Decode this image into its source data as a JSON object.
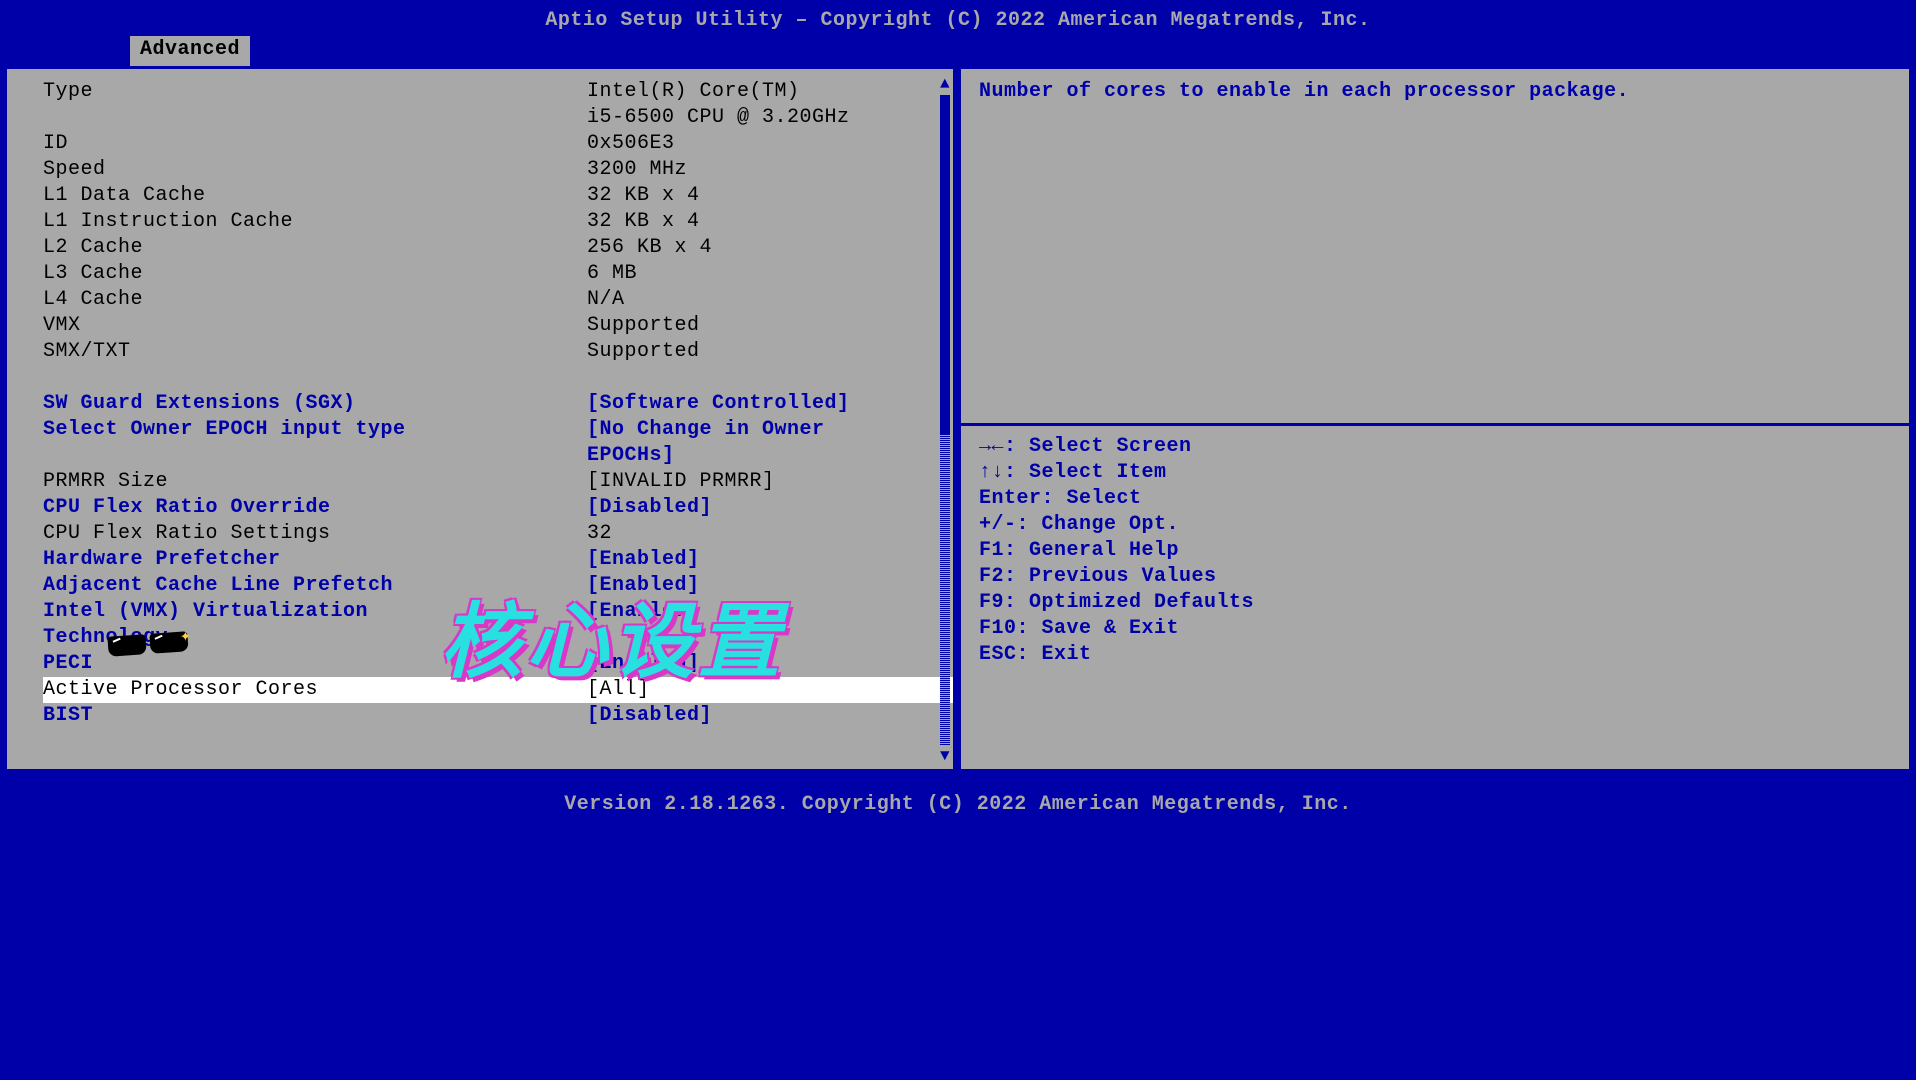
{
  "header": "Aptio Setup Utility – Copyright (C) 2022 American Megatrends, Inc.",
  "tab": "Advanced",
  "footer": "Version 2.18.1263. Copyright (C) 2022 American Megatrends, Inc.",
  "overlay": "核心设置",
  "left": {
    "info": [
      {
        "label": "Type",
        "value": "Intel(R) Core(TM)"
      },
      {
        "label": "",
        "value": "i5-6500 CPU @ 3.20GHz"
      },
      {
        "label": "ID",
        "value": "0x506E3"
      },
      {
        "label": "Speed",
        "value": "3200 MHz"
      },
      {
        "label": "L1 Data Cache",
        "value": "32 KB x 4"
      },
      {
        "label": "L1 Instruction Cache",
        "value": "32 KB x 4"
      },
      {
        "label": "L2 Cache",
        "value": "256 KB x 4"
      },
      {
        "label": "L3 Cache",
        "value": "6 MB"
      },
      {
        "label": "L4 Cache",
        "value": "N/A"
      },
      {
        "label": "VMX",
        "value": "Supported"
      },
      {
        "label": "SMX/TXT",
        "value": "Supported"
      }
    ],
    "options": [
      {
        "label": "SW Guard Extensions (SGX)",
        "value": "[Software Controlled]",
        "editable": true
      },
      {
        "label": "Select Owner EPOCH input type",
        "value": "[No Change in Owner",
        "editable": true
      },
      {
        "label": "",
        "value": "EPOCHs]",
        "editable": true,
        "continuation": true
      },
      {
        "label": "PRMRR Size",
        "value": "[INVALID PRMRR]",
        "editable": false
      },
      {
        "label": "CPU Flex Ratio Override",
        "value": "[Disabled]",
        "editable": true
      },
      {
        "label": "CPU Flex Ratio Settings",
        "value": "32",
        "editable": false
      },
      {
        "label": "Hardware Prefetcher",
        "value": "[Enabled]",
        "editable": true
      },
      {
        "label": "Adjacent Cache Line Prefetch",
        "value": "[Enabled]",
        "editable": true
      },
      {
        "label": "Intel (VMX) Virtualization",
        "value": "[Enabled]",
        "editable": true
      },
      {
        "label": "Technology",
        "value": "",
        "editable": true,
        "continuation": true
      },
      {
        "label": "PECI",
        "value": "[Enabled]",
        "editable": true
      },
      {
        "label": "Active Processor Cores",
        "value": "[All]",
        "editable": true,
        "selected": true
      },
      {
        "label": "BIST",
        "value": "[Disabled]",
        "editable": true
      }
    ]
  },
  "help": {
    "description": "Number of cores to enable in each processor package.",
    "keys": [
      "→←: Select Screen",
      "↑↓: Select Item",
      "Enter: Select",
      "+/-: Change Opt.",
      "F1: General Help",
      "F2: Previous Values",
      "F9: Optimized Defaults",
      "F10: Save & Exit",
      "ESC: Exit"
    ]
  }
}
